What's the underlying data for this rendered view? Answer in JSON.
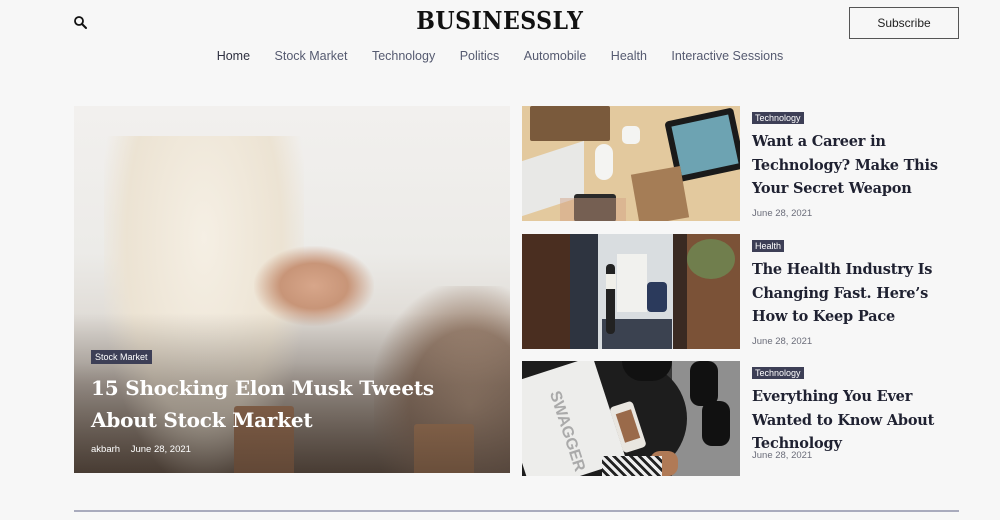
{
  "header": {
    "logo": "BUSINESSLY",
    "search_icon": "search-icon",
    "subscribe_label": "Subscribe",
    "nav": [
      {
        "label": "Home",
        "active": true
      },
      {
        "label": "Stock Market"
      },
      {
        "label": "Technology"
      },
      {
        "label": "Politics"
      },
      {
        "label": "Automobile"
      },
      {
        "label": "Health"
      },
      {
        "label": "Interactive Sessions"
      }
    ]
  },
  "featured": {
    "category": "Stock Market",
    "title": "15 Shocking Elon Musk Tweets About Stock Market",
    "author": "akbarh",
    "date": "June 28, 2021",
    "image": "handshake-photo"
  },
  "articles": [
    {
      "category": "Technology",
      "title": "Want a Career in Technology? Make This Your Secret Weapon",
      "date": "June 28, 2021",
      "image": "desk-gadgets-photo"
    },
    {
      "category": "Health",
      "title": "The Health Industry Is Changing Fast. Here’s How to Keep Pace",
      "date": "June 28, 2021",
      "image": "office-meeting-photo"
    },
    {
      "category": "Technology",
      "title": "Everything You Ever Wanted to Know About Technology",
      "date": "June 28, 2021",
      "image": "swagger-magazine-photo"
    }
  ],
  "colors": {
    "background": "#f7f7f7",
    "category_badge": "#3d3f56",
    "divider": "#a9abbd",
    "text_dark": "#1f2131"
  }
}
